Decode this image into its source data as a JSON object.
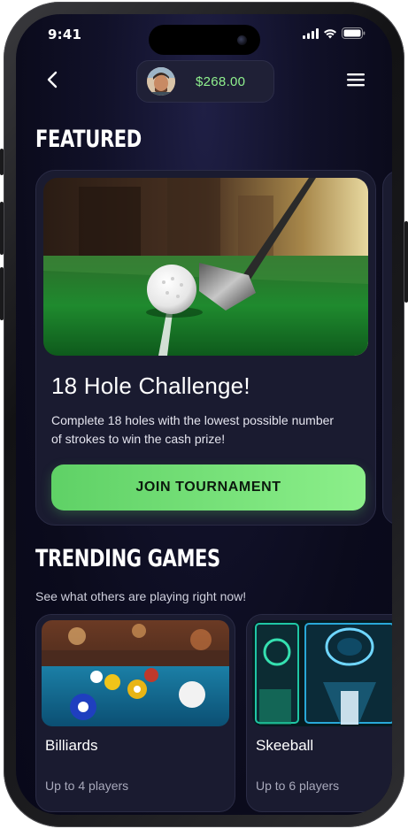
{
  "status_bar": {
    "time": "9:41"
  },
  "header": {
    "balance": "$268.00"
  },
  "featured": {
    "section_title": "FEATURED",
    "card": {
      "title": "18 Hole Challenge!",
      "description": "Complete 18 holes with the lowest possible number of strokes to win the cash prize!",
      "button_label": "JOIN TOURNAMENT"
    }
  },
  "trending": {
    "section_title": "TRENDING GAMES",
    "subtitle": "See what others are playing right now!",
    "games": [
      {
        "name": "Billiards",
        "players": "Up to 4 players"
      },
      {
        "name": "Skeeball",
        "players": "Up to 6 players"
      }
    ]
  },
  "colors": {
    "accent_green": "#7be07a",
    "background": "#0b0b1c",
    "card": "#1a1b30"
  }
}
